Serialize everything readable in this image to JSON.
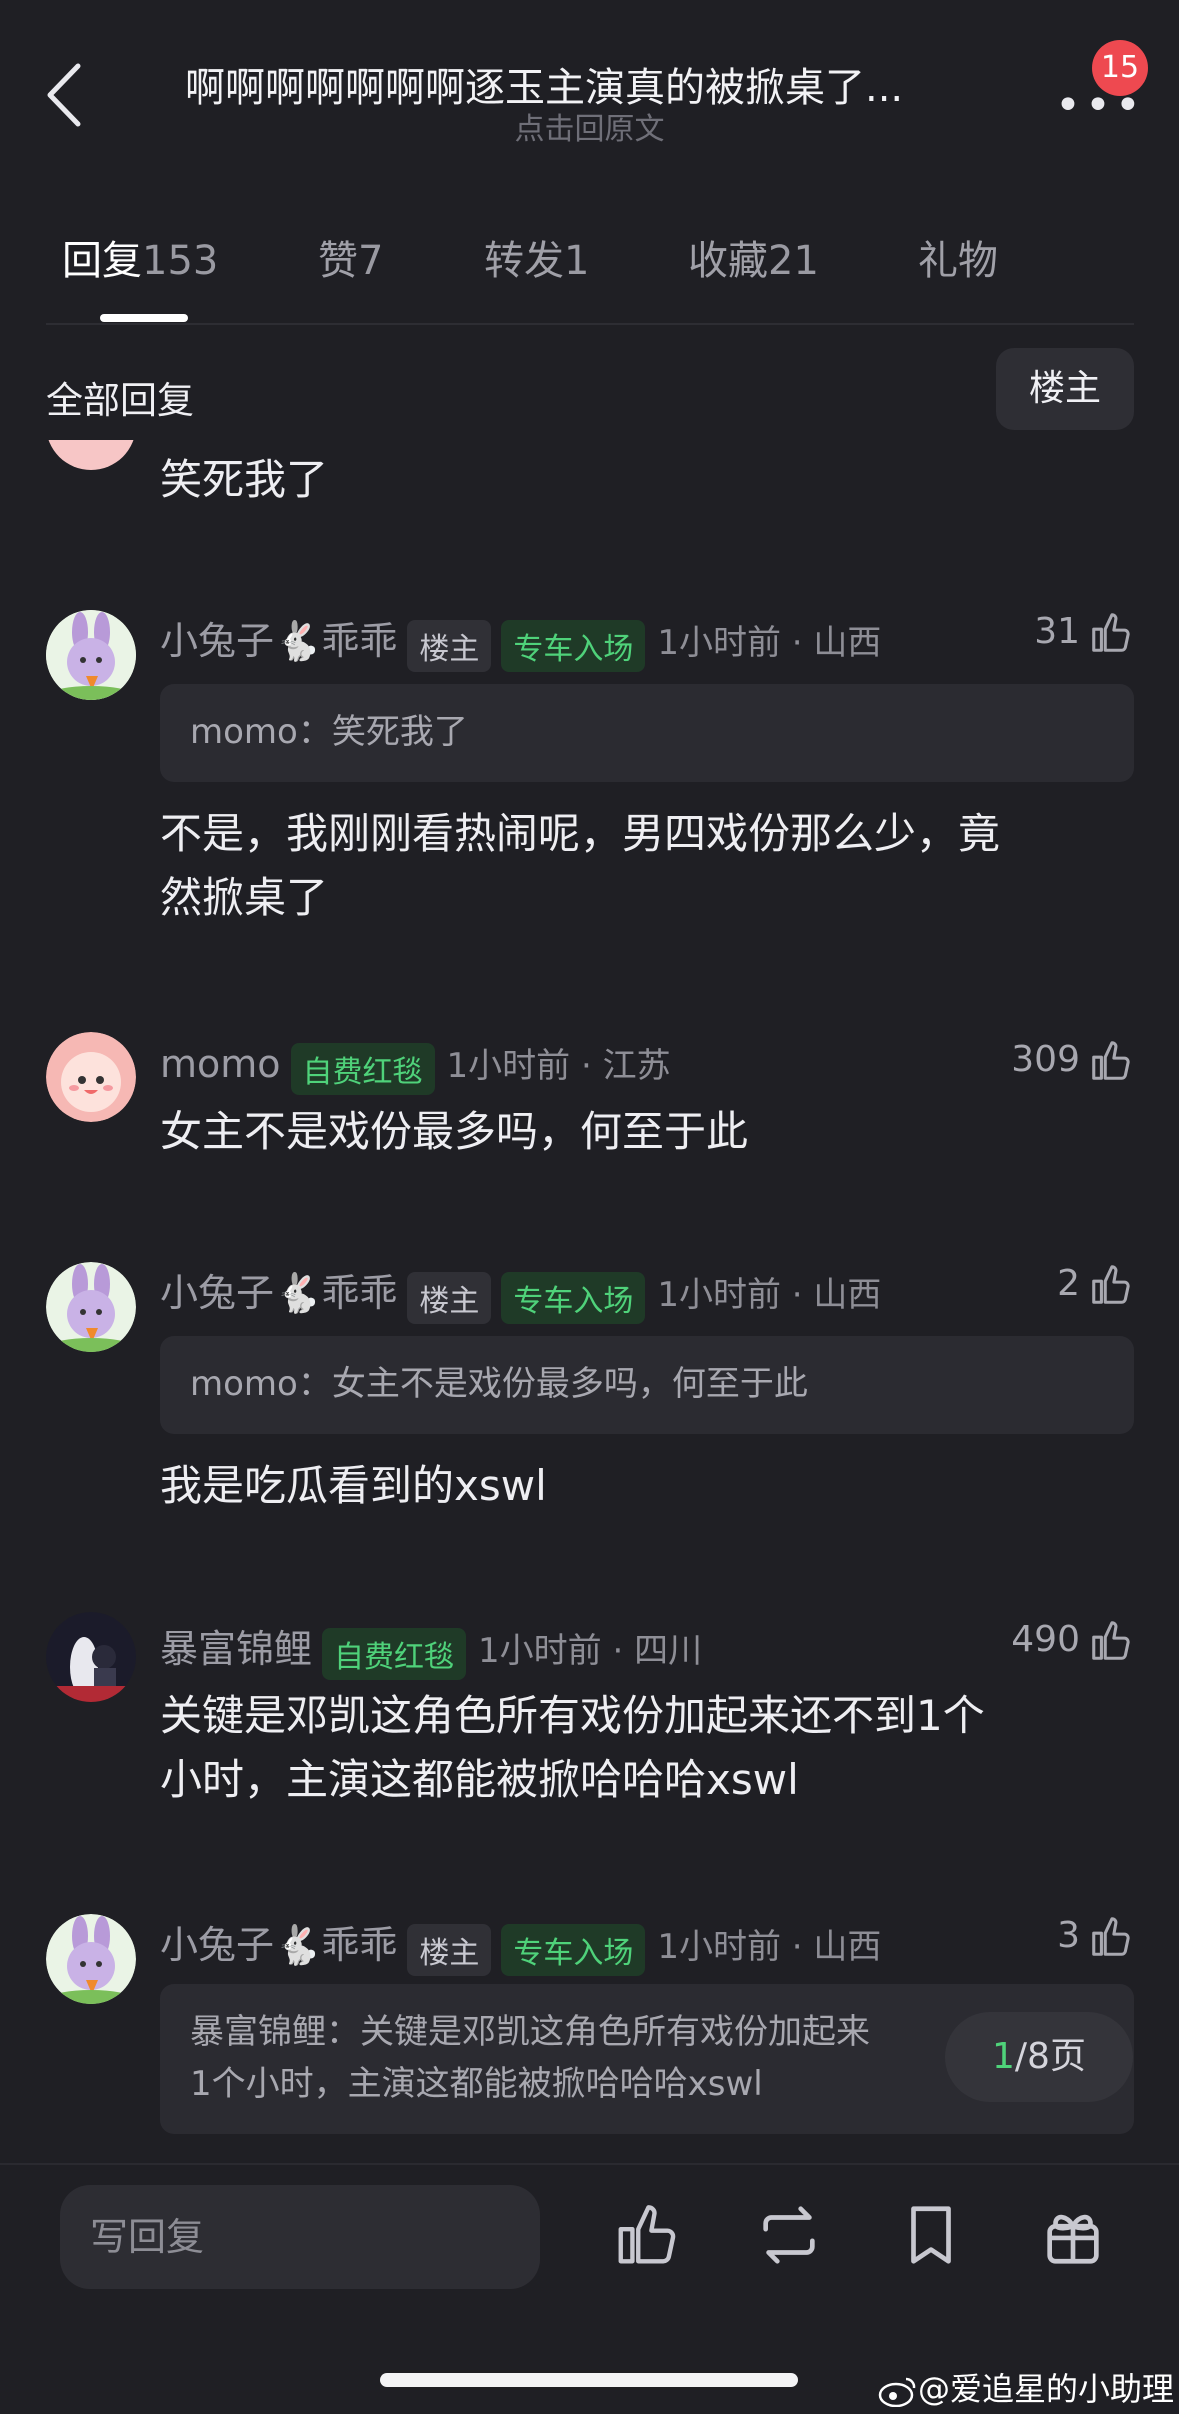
{
  "header": {
    "title": "啊啊啊啊啊啊啊逐玉主演真的被掀桌了...",
    "subtitle": "点击回原文",
    "badge_count": "15"
  },
  "tabs": [
    {
      "label": "回复",
      "count": "153",
      "active": true
    },
    {
      "label": "赞",
      "count": "7"
    },
    {
      "label": "转发",
      "count": "1"
    },
    {
      "label": "收藏",
      "count": "21"
    },
    {
      "label": "礼物",
      "count": ""
    }
  ],
  "section": {
    "title": "全部回复",
    "filter_button": "楼主"
  },
  "partial_comment": {
    "text": "笑死我了"
  },
  "comments": [
    {
      "user": "小兔子🐇乖乖",
      "tags": [
        "楼主",
        "专车入场"
      ],
      "time": "1小时前 · 山西",
      "likes": "31",
      "quote": "momo：笑死我了",
      "text_line1": "不是，我刚刚看热闹呢，男四戏份那么少，竟",
      "text_line2": "然掀桌了"
    },
    {
      "user": "momo",
      "tags": [
        "自费红毯"
      ],
      "time": "1小时前 · 江苏",
      "likes": "309",
      "text_line1": "女主不是戏份最多吗，何至于此"
    },
    {
      "user": "小兔子🐇乖乖",
      "tags": [
        "楼主",
        "专车入场"
      ],
      "time": "1小时前 · 山西",
      "likes": "2",
      "quote": "momo：女主不是戏份最多吗，何至于此",
      "text_line1": "我是吃瓜看到的xswl"
    },
    {
      "user": "暴富锦鲤",
      "tags": [
        "自费红毯"
      ],
      "time": "1小时前 · 四川",
      "likes": "490",
      "text_line1": "关键是邓凯这角色所有戏份加起来还不到1个",
      "text_line2": "小时，主演这都能被掀哈哈哈xswl"
    },
    {
      "user": "小兔子🐇乖乖",
      "tags": [
        "楼主",
        "专车入场"
      ],
      "time": "1小时前 · 山西",
      "likes": "3",
      "quote_line1": "暴富锦鲤：关键是邓凯这角色所有戏份加起来",
      "quote_line2": "1个小时，主演这都能被掀哈哈哈xswl"
    }
  ],
  "pager": {
    "current": "1",
    "total": "/8页"
  },
  "bottom": {
    "reply_placeholder": "写回复"
  },
  "watermark": "@爱追星的小助理",
  "colors": {
    "background": "#1f1f24",
    "green_tag": "#4fd27a",
    "badge": "#ee4950"
  }
}
